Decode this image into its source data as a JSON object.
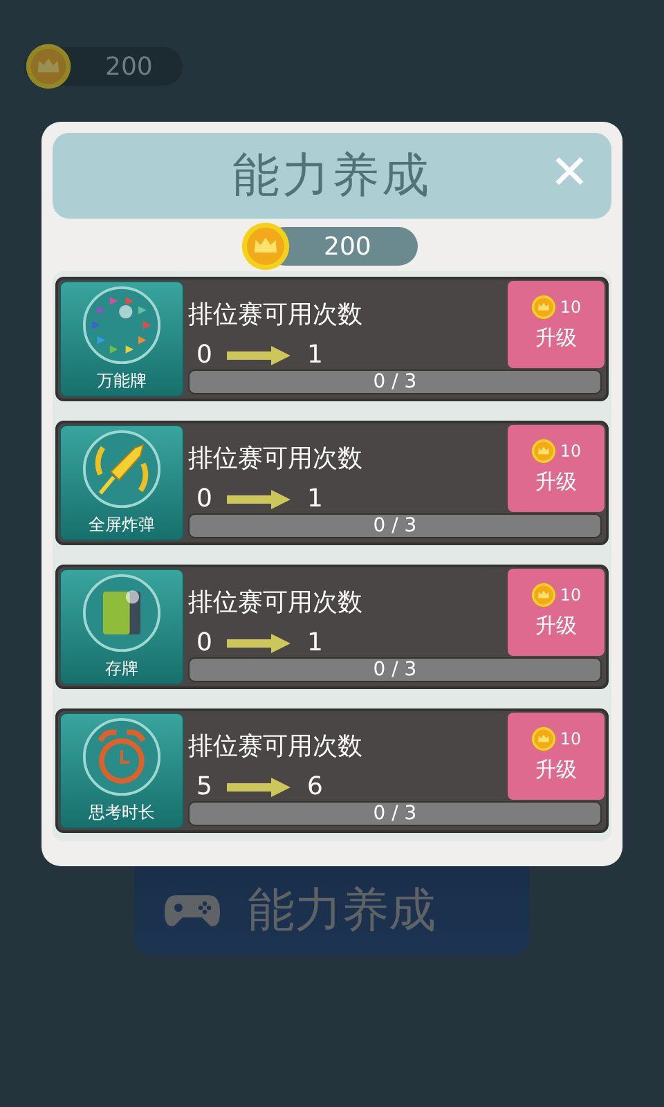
{
  "top_coins": {
    "amount": "200"
  },
  "dialog": {
    "title": "能力养成",
    "close": "✕",
    "coins": "200",
    "items": [
      {
        "name": "万能牌",
        "label": "排位赛可用次数",
        "from": "0",
        "to": "1",
        "progress": "0 / 3",
        "level": 0,
        "cost": "10",
        "action": "升级"
      },
      {
        "name": "全屏炸弹",
        "label": "排位赛可用次数",
        "from": "0",
        "to": "1",
        "progress": "0 / 3",
        "level": 0,
        "cost": "10",
        "action": "升级"
      },
      {
        "name": "存牌",
        "label": "排位赛可用次数",
        "from": "0",
        "to": "1",
        "progress": "0 / 3",
        "level": 0,
        "cost": "10",
        "action": "升级"
      },
      {
        "name": "思考时长",
        "label": "排位赛可用次数",
        "from": "5",
        "to": "6",
        "progress": "0 / 3",
        "level": 0,
        "cost": "10",
        "action": "升级"
      }
    ]
  },
  "menu_button": {
    "label": "能力养成"
  }
}
